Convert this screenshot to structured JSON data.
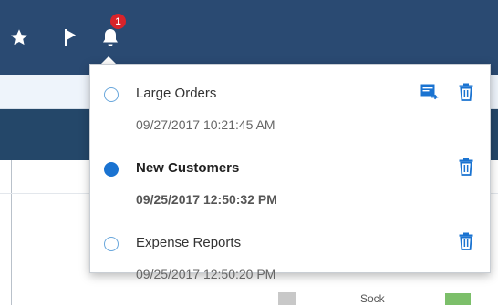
{
  "header": {
    "icons": [
      "star-icon",
      "flag-icon",
      "bell-icon"
    ],
    "notification_count": "1",
    "bar_color": "#2a4a72",
    "badge_color": "#d8232a"
  },
  "background": {
    "peek_text": "Sock"
  },
  "notifications": [
    {
      "title": "Large Orders",
      "timestamp": "09/27/2017 10:21:45 AM",
      "unread": false,
      "actions": [
        "open-in-window-icon",
        "trash-icon"
      ]
    },
    {
      "title": "New Customers",
      "timestamp": "09/25/2017 12:50:32 PM",
      "unread": true,
      "actions": [
        "trash-icon"
      ]
    },
    {
      "title": "Expense Reports",
      "timestamp": "09/25/2017 12:50:20 PM",
      "unread": false,
      "actions": [
        "trash-icon"
      ]
    }
  ],
  "accent_color": "#1a73d1"
}
